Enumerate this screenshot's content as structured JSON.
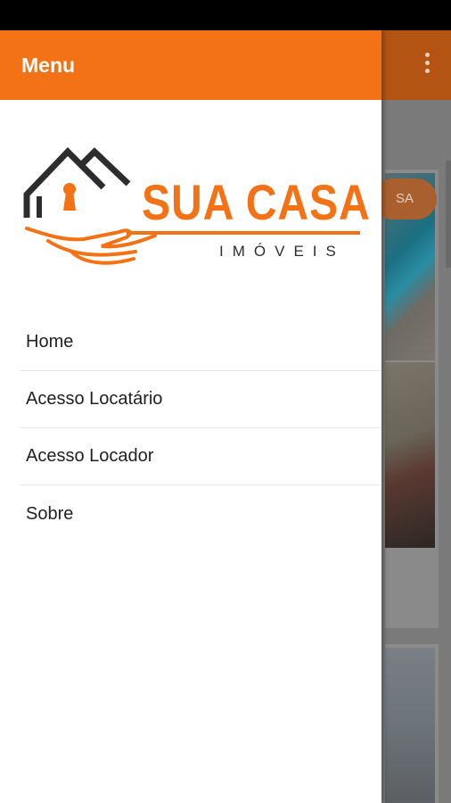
{
  "drawer": {
    "title": "Menu",
    "logo": {
      "main": "SUA CASA",
      "sub": "IMÓVEIS",
      "brand_color": "#f47216"
    },
    "items": [
      {
        "label": "Home"
      },
      {
        "label": "Acesso Locatário"
      },
      {
        "label": "Acesso Locador"
      },
      {
        "label": "Sobre"
      }
    ]
  },
  "background": {
    "pill_text": "SA",
    "overflow_icon": "more-vert-icon"
  },
  "colors": {
    "accent": "#f47216",
    "toolbar_dim": "#b35413"
  }
}
